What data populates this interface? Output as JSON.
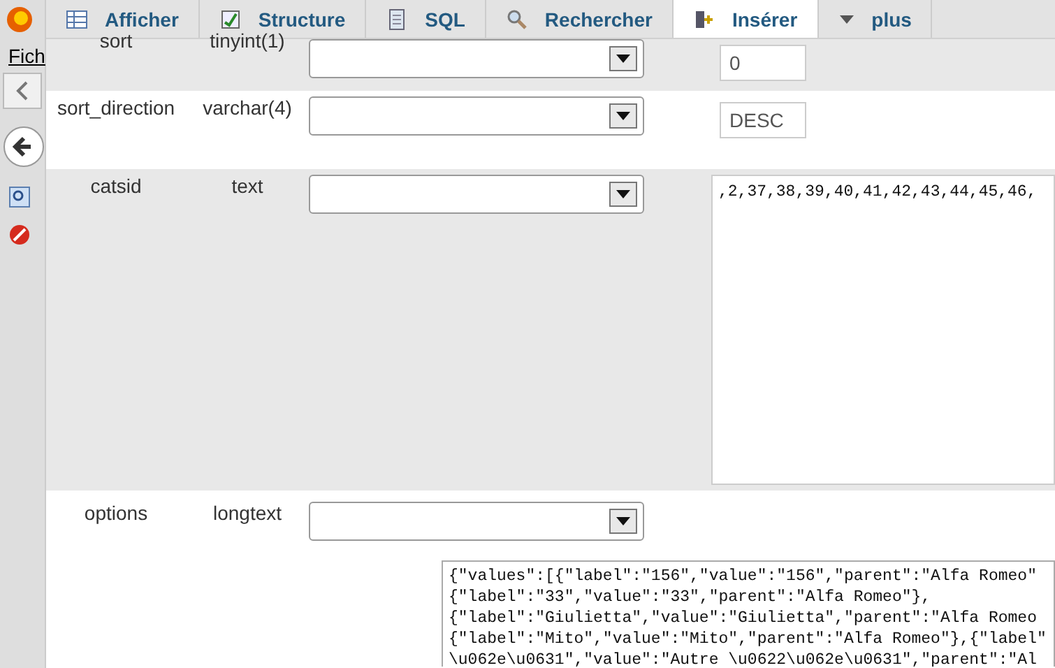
{
  "browser": {
    "menu_fragment": "Fich"
  },
  "tabs": [
    {
      "label": "Afficher",
      "selected": false,
      "kind": "table"
    },
    {
      "label": "Structure",
      "selected": false,
      "kind": "structure"
    },
    {
      "label": "SQL",
      "selected": false,
      "kind": "sql"
    },
    {
      "label": "Rechercher",
      "selected": false,
      "kind": "search"
    },
    {
      "label": "Insérer",
      "selected": true,
      "kind": "insert"
    },
    {
      "label": "plus",
      "selected": false,
      "kind": "menu"
    }
  ],
  "rows": [
    {
      "name": "sort",
      "type": "tinyint(1)",
      "kind": "input",
      "value": "0",
      "lines": []
    },
    {
      "name": "sort_direction",
      "type": "varchar(4)",
      "kind": "input",
      "value": "DESC",
      "lines": []
    },
    {
      "name": "catsid",
      "type": "text",
      "kind": "textarea",
      "value": "",
      "lines": [
        ",2,37,38,39,40,41,42,43,44,45,46,"
      ]
    },
    {
      "name": "options",
      "type": "longtext",
      "kind": "wide-textarea",
      "value": "",
      "lines": [
        "{\"values\":[{\"label\":\"156\",\"value\":\"156\",\"parent\":\"Alfa Romeo\"",
        "{\"label\":\"33\",\"value\":\"33\",\"parent\":\"Alfa Romeo\"},",
        "{\"label\":\"Giulietta\",\"value\":\"Giulietta\",\"parent\":\"Alfa Romeo",
        "{\"label\":\"Mito\",\"value\":\"Mito\",\"parent\":\"Alfa Romeo\"},{\"label\"",
        "\\u062e\\u0631\",\"value\":\"Autre \\u0622\\u062e\\u0631\",\"parent\":\"Al"
      ]
    }
  ]
}
